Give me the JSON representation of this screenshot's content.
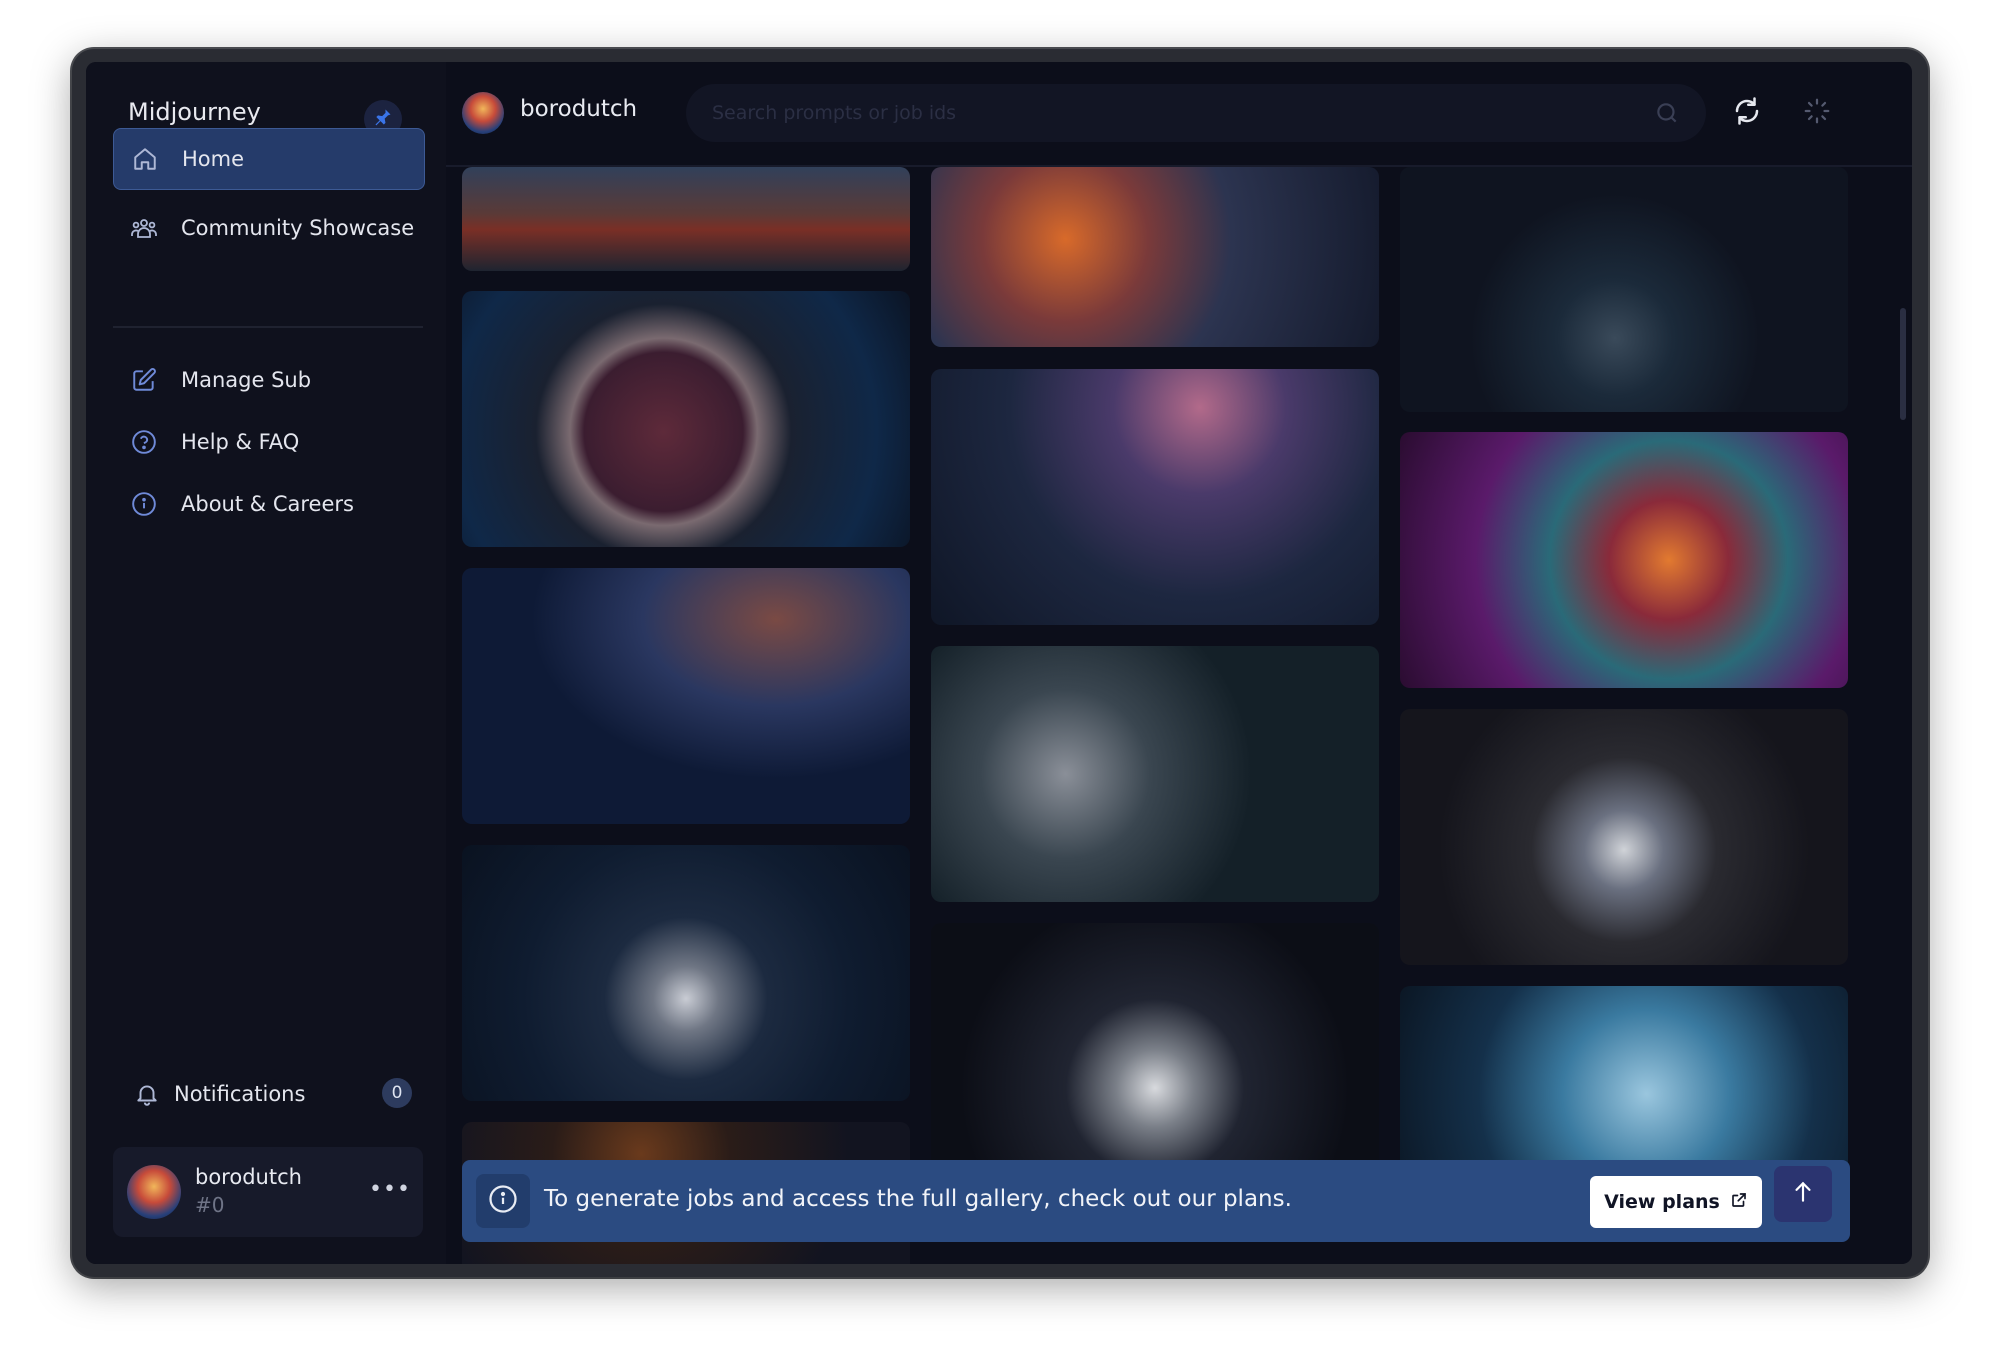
{
  "sidebar": {
    "brand": "Midjourney",
    "nav_primary": [
      {
        "label": "Home",
        "icon": "home-icon",
        "active": true
      },
      {
        "label": "Community Showcase",
        "icon": "community-icon",
        "active": false
      }
    ],
    "nav_secondary": [
      {
        "label": "Manage Sub",
        "icon": "edit-icon"
      },
      {
        "label": "Help & FAQ",
        "icon": "help-icon"
      },
      {
        "label": "About & Careers",
        "icon": "info-icon"
      }
    ],
    "notifications": {
      "label": "Notifications",
      "count": "0"
    },
    "user": {
      "name": "borodutch",
      "tag": "#0",
      "more": "•••"
    }
  },
  "header": {
    "username": "borodutch",
    "search_placeholder": "Search prompts or job ids"
  },
  "banner": {
    "message": "To generate jobs and access the full gallery, check out our plans.",
    "button_label": "View plans"
  },
  "colors": {
    "background": "#0c0e1a",
    "active_nav": "#253b6a",
    "banner": "#2b4b81"
  }
}
